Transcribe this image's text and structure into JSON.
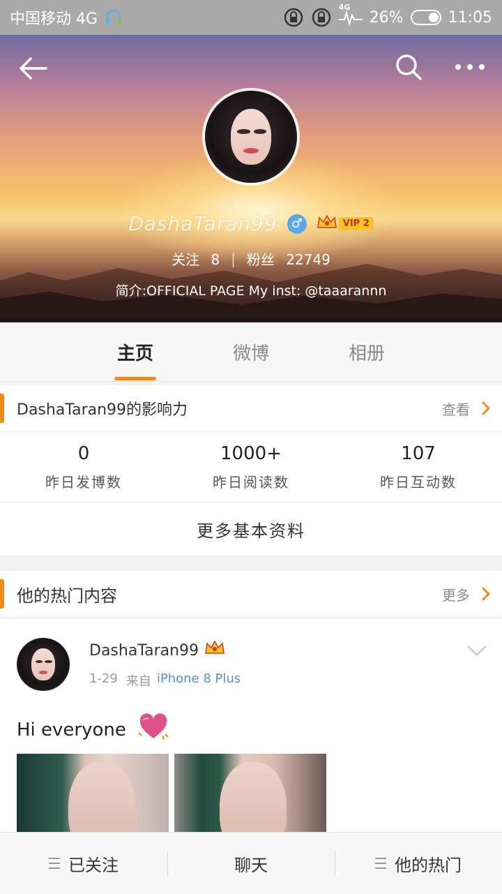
{
  "status_bar": {
    "carrier": "中国移动 4G",
    "network": "4G",
    "battery": "26%",
    "time": "11:05"
  },
  "profile": {
    "username": "DashaTaran99",
    "vip_label": "VIP 2",
    "following_label": "关注",
    "following_count": "8",
    "separator": "|",
    "followers_label": "粉丝",
    "followers_count": "22749",
    "bio": "简介:OFFICIAL PAGE  My inst: @taaarannn"
  },
  "tabs": [
    {
      "label": "主页",
      "active": true
    },
    {
      "label": "微博",
      "active": false
    },
    {
      "label": "相册",
      "active": false
    }
  ],
  "influence": {
    "title": "DashaTaran99的影响力",
    "view_label": "查看",
    "stats": [
      {
        "value": "0",
        "label": "昨日发博数"
      },
      {
        "value": "1000+",
        "label": "昨日阅读数"
      },
      {
        "value": "107",
        "label": "昨日互动数"
      }
    ],
    "more_info_label": "更多基本资料"
  },
  "hot": {
    "title": "他的热门内容",
    "more_label": "更多"
  },
  "post": {
    "author": "DashaTaran99",
    "date": "1-29",
    "from_label": "来自",
    "source": "iPhone 8 Plus",
    "text": "Hi everyone"
  },
  "bottom_bar": {
    "followed_label": "已关注",
    "chat_label": "聊天",
    "hot_label": "他的热门"
  },
  "colors": {
    "accent": "#f08c1a",
    "link": "#5b8fc7",
    "vip_gold": "#f7c02d"
  }
}
